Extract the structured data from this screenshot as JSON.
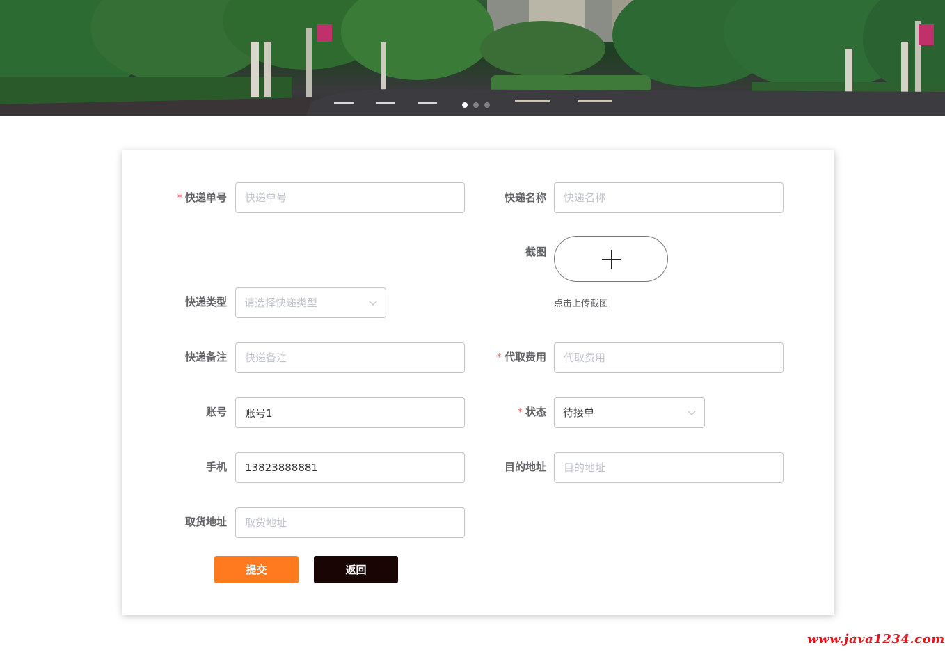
{
  "banner": {
    "slide_count": 3,
    "active_slide": 1
  },
  "form": {
    "fields": {
      "tracking_no": {
        "label": "快递单号",
        "required": true,
        "placeholder": "快递单号",
        "value": ""
      },
      "courier_name": {
        "label": "快递名称",
        "required": false,
        "placeholder": "快递名称",
        "value": ""
      },
      "screenshot": {
        "label": "截图",
        "hint": "点击上传截图"
      },
      "courier_type": {
        "label": "快递类型",
        "required": false,
        "placeholder": "请选择快递类型",
        "value": ""
      },
      "remark": {
        "label": "快递备注",
        "required": false,
        "placeholder": "快递备注",
        "value": ""
      },
      "fee": {
        "label": "代取费用",
        "required": true,
        "placeholder": "代取费用",
        "value": ""
      },
      "account": {
        "label": "账号",
        "required": false,
        "placeholder": "",
        "value": "账号1"
      },
      "status": {
        "label": "状态",
        "required": true,
        "value": "待接单"
      },
      "phone": {
        "label": "手机",
        "required": false,
        "placeholder": "",
        "value": "13823888881"
      },
      "destination": {
        "label": "目的地址",
        "required": false,
        "placeholder": "目的地址",
        "value": ""
      },
      "pickup_address": {
        "label": "取货地址",
        "required": false,
        "placeholder": "取货地址",
        "value": ""
      }
    },
    "buttons": {
      "submit": "提交",
      "back": "返回"
    },
    "required_mark": "*"
  },
  "watermark": "www.java1234.com",
  "colors": {
    "submit_bg": "#ff7a1f",
    "back_bg": "#1a0505",
    "required": "#f56c6c"
  }
}
